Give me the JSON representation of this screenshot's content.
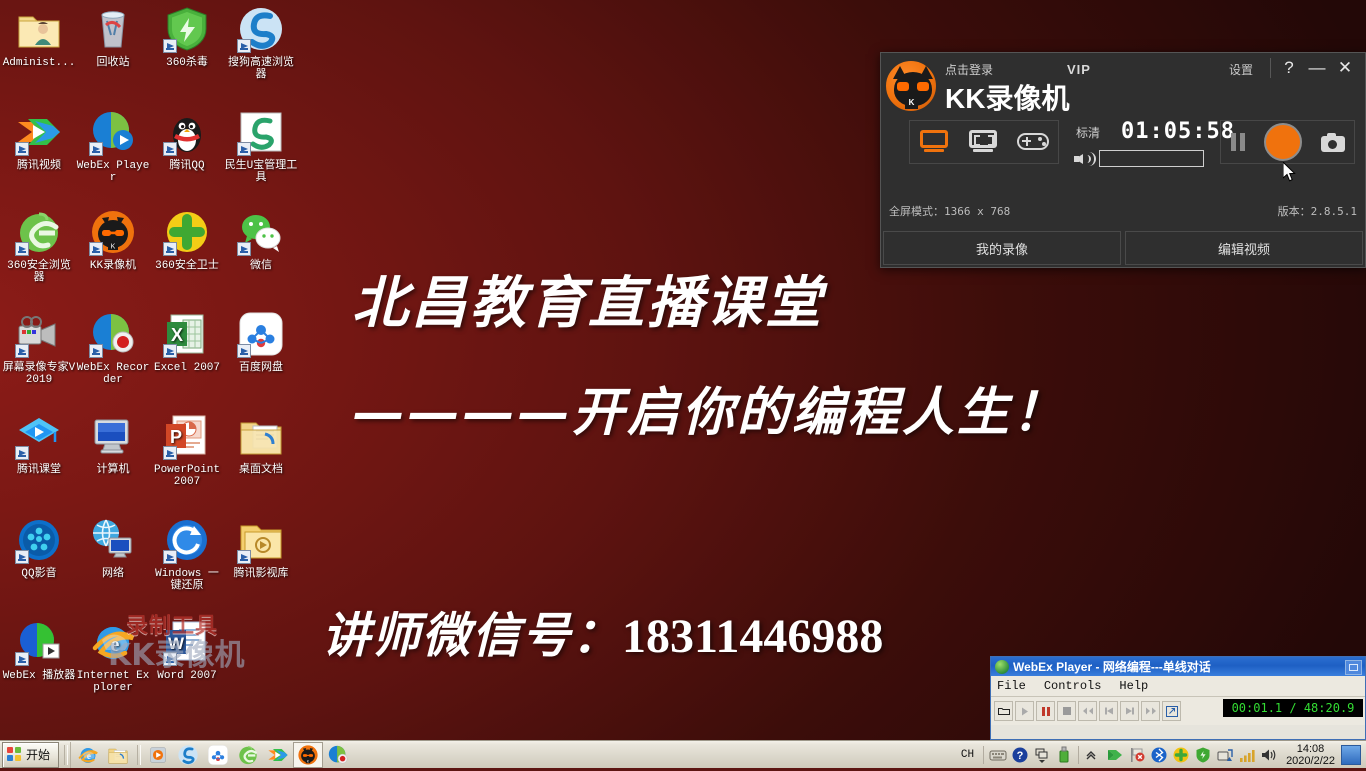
{
  "desktop": {
    "background_color_left": "#8e1c18",
    "background_color_right": "#230807",
    "banner_line1": "北昌教育直播课堂",
    "banner_line2": "————开启你的编程人生！",
    "banner_line3_label": "讲师微信号：",
    "banner_line3_number": "18311446988",
    "watermark_top": "录制工具",
    "watermark_bottom": "KK录像机",
    "icons": [
      {
        "label": "Administ...",
        "name": "administrator-folder",
        "shortcut": false
      },
      {
        "label": "回收站",
        "name": "recycle-bin",
        "shortcut": false
      },
      {
        "label": "360杀毒",
        "name": "360-antivirus",
        "shortcut": true
      },
      {
        "label": "搜狗高速浏览器",
        "name": "sogou-browser",
        "shortcut": true
      },
      {
        "label": "腾讯视频",
        "name": "tencent-video",
        "shortcut": true
      },
      {
        "label": "WebEx Player",
        "name": "webex-player",
        "shortcut": true
      },
      {
        "label": "腾讯QQ",
        "name": "tencent-qq",
        "shortcut": true
      },
      {
        "label": "民生U宝管理工具",
        "name": "cmbc-ubao-tool",
        "shortcut": true
      },
      {
        "label": "360安全浏览器",
        "name": "360-secure-browser",
        "shortcut": true
      },
      {
        "label": "KK录像机",
        "name": "kk-recorder",
        "shortcut": true
      },
      {
        "label": "360安全卫士",
        "name": "360-safeguard",
        "shortcut": true
      },
      {
        "label": "微信",
        "name": "wechat",
        "shortcut": true
      },
      {
        "label": "屏幕录像专家V2019",
        "name": "screen-recorder-expert",
        "shortcut": true
      },
      {
        "label": "WebEx Recorder",
        "name": "webex-recorder",
        "shortcut": true
      },
      {
        "label": "Excel 2007",
        "name": "excel-2007",
        "shortcut": true
      },
      {
        "label": "百度网盘",
        "name": "baidu-netdisk",
        "shortcut": true
      },
      {
        "label": "腾讯课堂",
        "name": "tencent-classroom",
        "shortcut": true
      },
      {
        "label": "计算机",
        "name": "my-computer",
        "shortcut": false
      },
      {
        "label": "PowerPoint 2007",
        "name": "powerpoint-2007",
        "shortcut": true
      },
      {
        "label": "桌面文档",
        "name": "desktop-documents",
        "shortcut": false
      },
      {
        "label": "QQ影音",
        "name": "qq-player",
        "shortcut": true
      },
      {
        "label": "网络",
        "name": "network",
        "shortcut": false
      },
      {
        "label": "Windows 一键还原",
        "name": "windows-one-key-restore",
        "shortcut": true
      },
      {
        "label": "腾讯影视库",
        "name": "tencent-video-library",
        "shortcut": true
      },
      {
        "label": "WebEx 播放器",
        "name": "webex-player-cn",
        "shortcut": true
      },
      {
        "label": "Internet Explorer",
        "name": "internet-explorer",
        "shortcut": false
      },
      {
        "label": "Word 2007",
        "name": "word-2007",
        "shortcut": true
      }
    ]
  },
  "kk_recorder": {
    "login_text": "点击登录",
    "vip_label": "VIP",
    "app_title": "KK录像机",
    "settings_label": "设置",
    "help_label": "?",
    "minimize_label": "—",
    "close_label": "✕",
    "quality_label": "标清",
    "timer": "01:05:58",
    "status_mode": "全屏模式：1366 x 768",
    "version": "版本：2.8.5.1",
    "footer_buttons": [
      "我的录像",
      "编辑视频"
    ],
    "accent_color": "#f0720d",
    "modes": [
      {
        "name": "fullscreen-mode-icon",
        "selected": true
      },
      {
        "name": "region-mode-icon",
        "selected": false
      },
      {
        "name": "game-mode-icon",
        "selected": false
      }
    ],
    "actions": [
      {
        "name": "pause-button"
      },
      {
        "name": "record-button"
      },
      {
        "name": "screenshot-button"
      }
    ]
  },
  "webex_player": {
    "window_title": "WebEx Player - 网络编程---单线对话",
    "menu": [
      "File",
      "Controls",
      "Help"
    ],
    "time_display": "00:01.1 / 48:20.9"
  },
  "taskbar": {
    "start_label": "开始",
    "quick_launch": [
      {
        "name": "taskbar-internet-explorer"
      },
      {
        "name": "taskbar-file-explorer"
      }
    ],
    "tasks": [
      {
        "name": "taskbar-media-player",
        "active": false
      },
      {
        "name": "taskbar-sogou-browser",
        "active": false
      },
      {
        "name": "taskbar-baidu-netdisk",
        "active": false
      },
      {
        "name": "taskbar-360-browser",
        "active": false
      },
      {
        "name": "taskbar-tencent-video",
        "active": false
      },
      {
        "name": "taskbar-kk-recorder",
        "active": true
      },
      {
        "name": "taskbar-webex-recorder",
        "active": false
      }
    ],
    "language_indicator": "CH",
    "clock_time": "14:08",
    "clock_date": "2020/2/22",
    "tray_icons": [
      {
        "name": "keyboard-icon"
      },
      {
        "name": "help-icon"
      },
      {
        "name": "window-switch-icon"
      },
      {
        "name": "usb-drive-icon"
      },
      {
        "name": "show-hidden-icons-chevron"
      },
      {
        "name": "tencent-video-tray-icon"
      },
      {
        "name": "flag-error-icon"
      },
      {
        "name": "bluetooth-icon"
      },
      {
        "name": "360-safeguard-tray-icon"
      },
      {
        "name": "360-antivirus-tray-icon"
      },
      {
        "name": "safely-remove-hardware-icon"
      },
      {
        "name": "network-signal-icon"
      },
      {
        "name": "volume-icon"
      }
    ]
  }
}
